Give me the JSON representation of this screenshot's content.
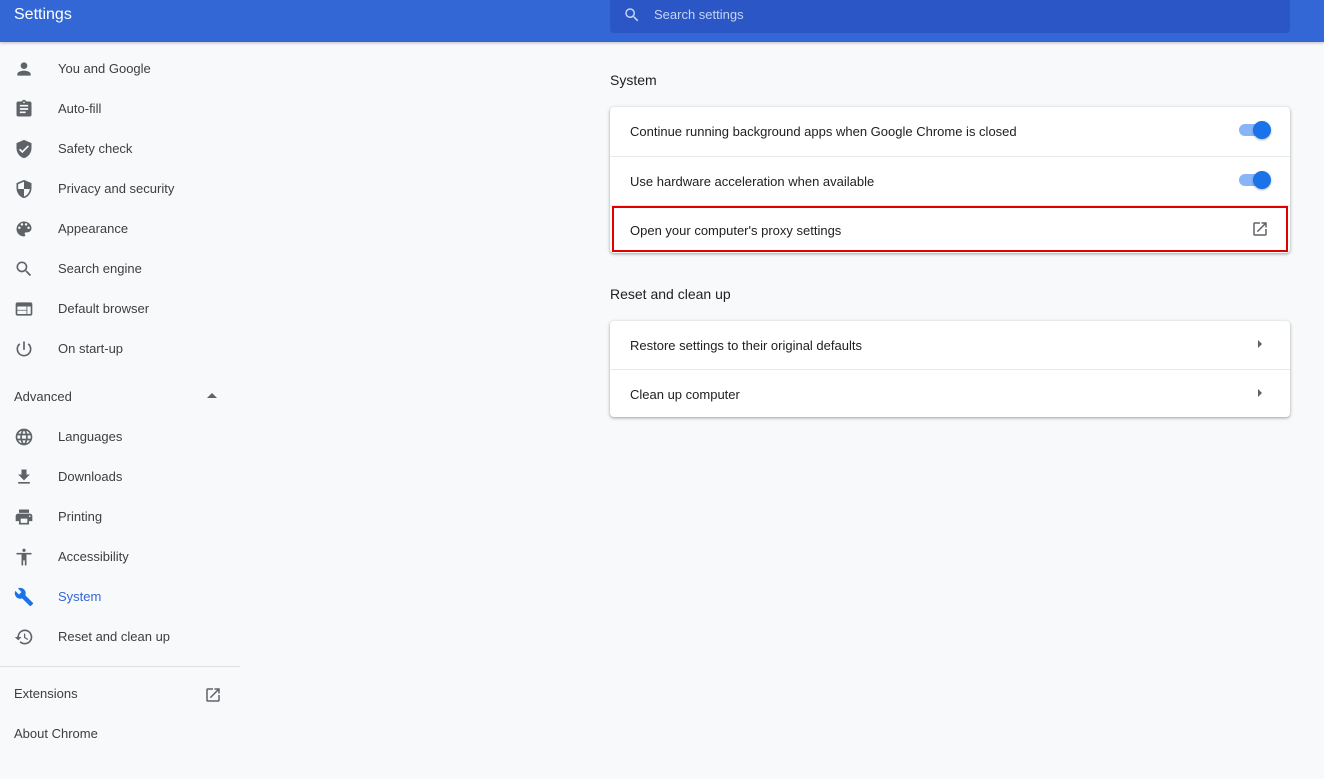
{
  "header": {
    "title": "Settings",
    "search_placeholder": "Search settings",
    "search_value": ""
  },
  "sidebar": {
    "items": [
      {
        "label": "You and Google",
        "icon": "person-icon"
      },
      {
        "label": "Auto-fill",
        "icon": "clipboard-icon"
      },
      {
        "label": "Safety check",
        "icon": "shield-check-icon"
      },
      {
        "label": "Privacy and security",
        "icon": "shield-half-icon"
      },
      {
        "label": "Appearance",
        "icon": "palette-icon"
      },
      {
        "label": "Search engine",
        "icon": "search-icon"
      },
      {
        "label": "Default browser",
        "icon": "browser-window-icon"
      },
      {
        "label": "On start-up",
        "icon": "power-icon"
      }
    ],
    "advanced_label": "Advanced",
    "advanced_items": [
      {
        "label": "Languages",
        "icon": "globe-icon"
      },
      {
        "label": "Downloads",
        "icon": "download-icon"
      },
      {
        "label": "Printing",
        "icon": "printer-icon"
      },
      {
        "label": "Accessibility",
        "icon": "accessibility-icon"
      },
      {
        "label": "System",
        "icon": "wrench-icon",
        "active": true
      },
      {
        "label": "Reset and clean up",
        "icon": "restore-icon"
      }
    ],
    "extensions_label": "Extensions",
    "about_label": "About Chrome"
  },
  "main": {
    "system": {
      "title": "System",
      "rows": [
        {
          "label": "Continue running background apps when Google Chrome is closed",
          "toggle": true
        },
        {
          "label": "Use hardware acceleration when available",
          "toggle": true
        },
        {
          "label": "Open your computer's proxy settings",
          "action": "launch-icon"
        }
      ]
    },
    "reset": {
      "title": "Reset and clean up",
      "rows": [
        {
          "label": "Restore settings to their original defaults"
        },
        {
          "label": "Clean up computer"
        }
      ]
    }
  },
  "colors": {
    "header": "#3367d6",
    "accent": "#1a73e8",
    "highlight": "#e00000"
  }
}
